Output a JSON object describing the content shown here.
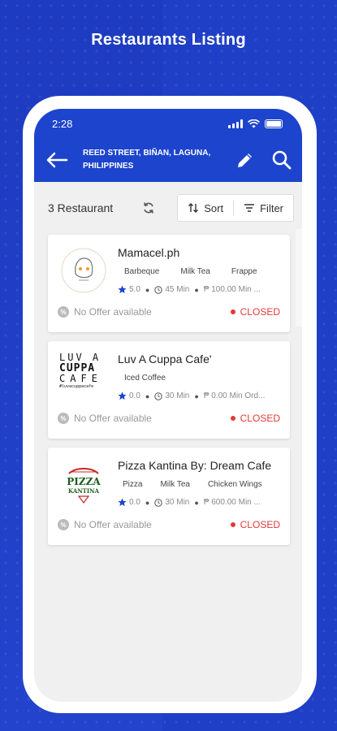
{
  "promo_title": "Restaurants Listing",
  "status": {
    "time": "2:28"
  },
  "header": {
    "address": "REED STREET, BIÑAN, LAGUNA, PHILIPPINES"
  },
  "filters": {
    "count": "3 Restaurant",
    "sort": "Sort",
    "filter": "Filter"
  },
  "restaurants": [
    {
      "name": "Mamacel.ph",
      "tags": [
        "Barbeque",
        "Milk Tea",
        "Frappe"
      ],
      "rating": "5.0",
      "time": "45 Min",
      "min_order": "₱ 100.00 Min ...",
      "offer": "No Offer available",
      "status": "CLOSED"
    },
    {
      "name": "Luv A Cuppa Cafe'",
      "tags": [
        "Iced Coffee"
      ],
      "rating": "0.0",
      "time": "30 Min",
      "min_order": "₱ 0.00 Min Ord...",
      "offer": "No Offer available",
      "status": "CLOSED",
      "logo_text": {
        "line1": "LUV A",
        "line2": "CUPPA",
        "line3": "CAFE",
        "line4": "#luvacuppacafe"
      }
    },
    {
      "name": "Pizza Kantina By: Dream Cafe",
      "tags": [
        "Pizza",
        "Milk Tea",
        "Chicken Wings"
      ],
      "rating": "0.0",
      "time": "30 Min",
      "min_order": "₱ 600.00 Min ...",
      "offer": "No Offer available",
      "status": "CLOSED",
      "logo_text": {
        "line1": "PIZZA",
        "line2": "KANTINA"
      }
    }
  ],
  "colors": {
    "primary": "#1d44cc",
    "closed": "#e53935",
    "star": "#1d44cc"
  }
}
